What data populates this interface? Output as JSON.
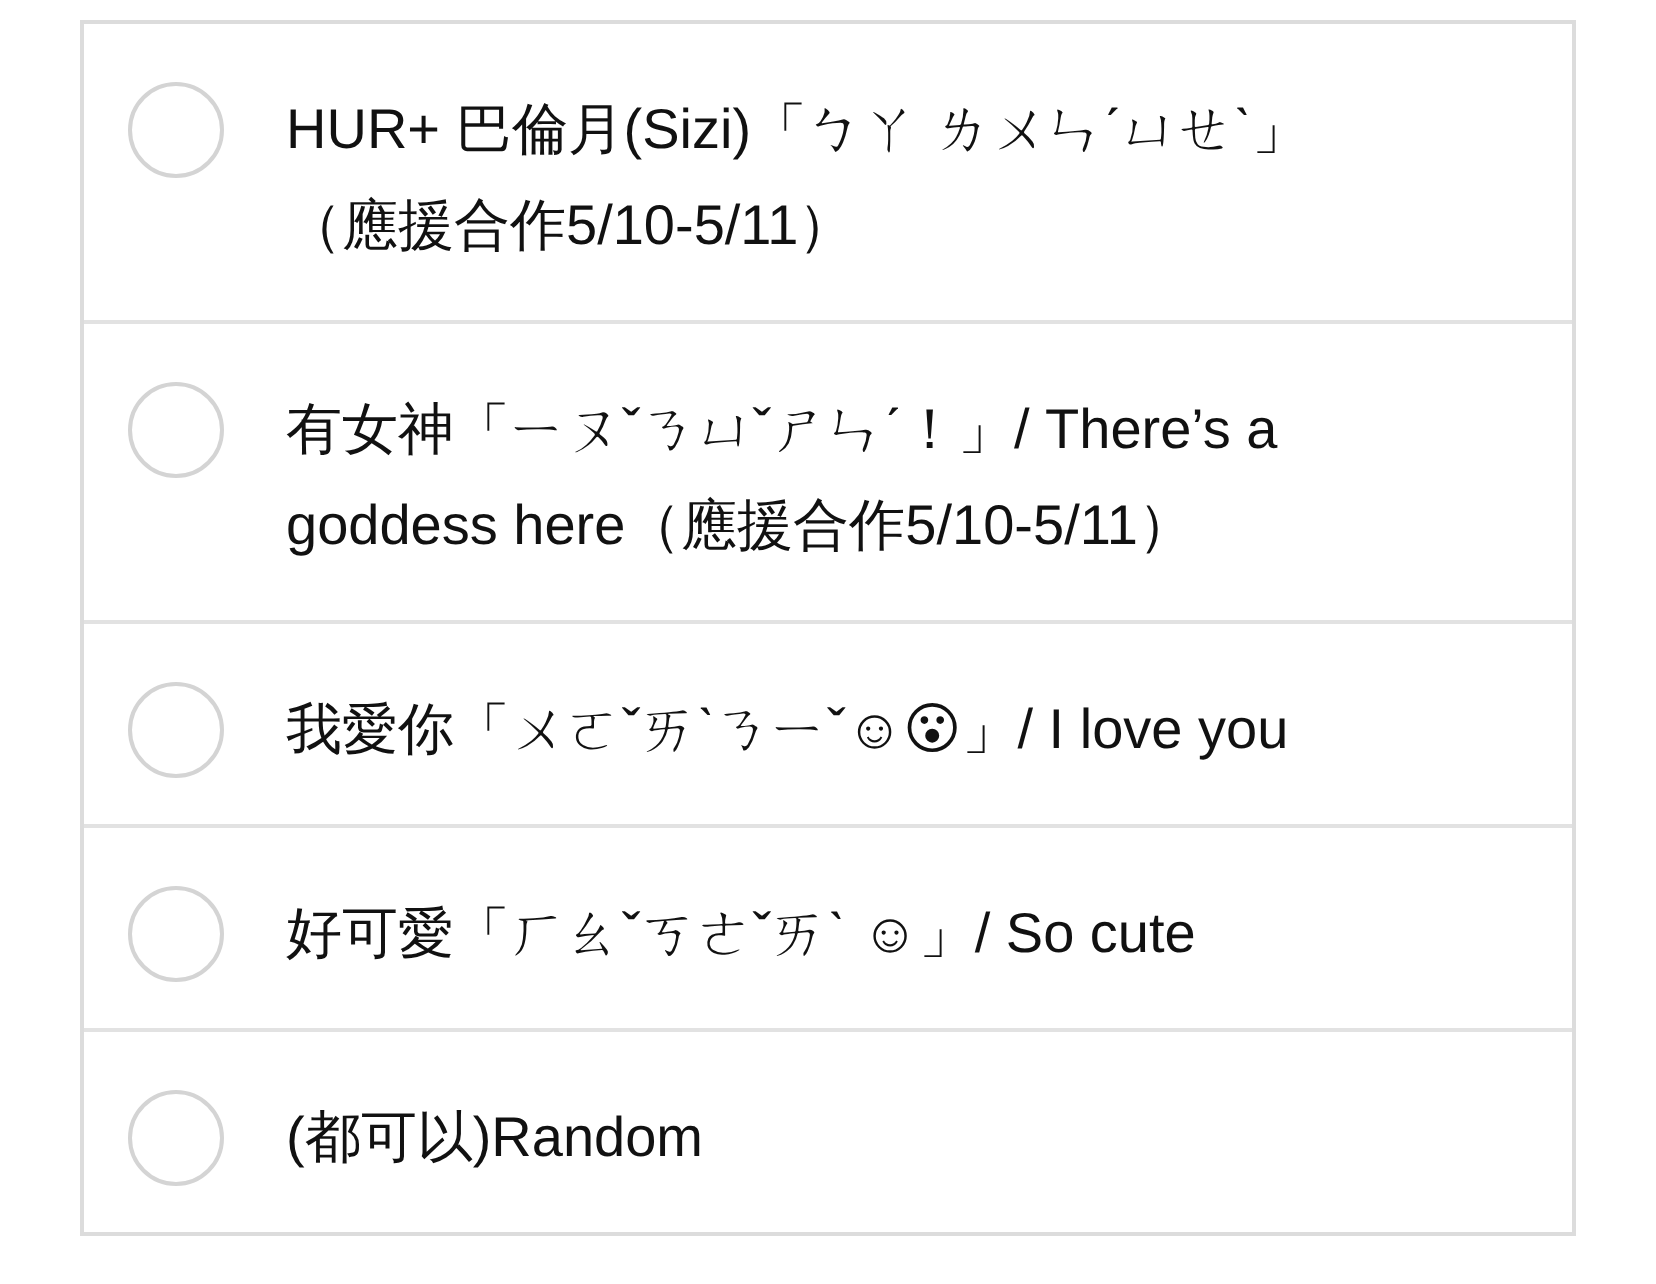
{
  "options": [
    {
      "label": "HUR+ 巴倫月(Sizi)「ㄅㄚ ㄌㄨㄣˊㄩㄝˋ」（應援合作5/10-5/11）",
      "selected": false
    },
    {
      "label": "有女神「ㄧㄡˇㄋㄩˇㄕㄣˊ！」/ There’s a goddess here（應援合作5/10-5/11）",
      "selected": false
    },
    {
      "label": "我愛你「ㄨㄛˇㄞˋㄋㄧˇ☺😮」/ I love you",
      "selected": false
    },
    {
      "label": "好可愛「ㄏㄠˇㄎㄜˇㄞˋ ☺」/ So cute",
      "selected": false
    },
    {
      "label": "(都可以)Random",
      "selected": false
    }
  ]
}
